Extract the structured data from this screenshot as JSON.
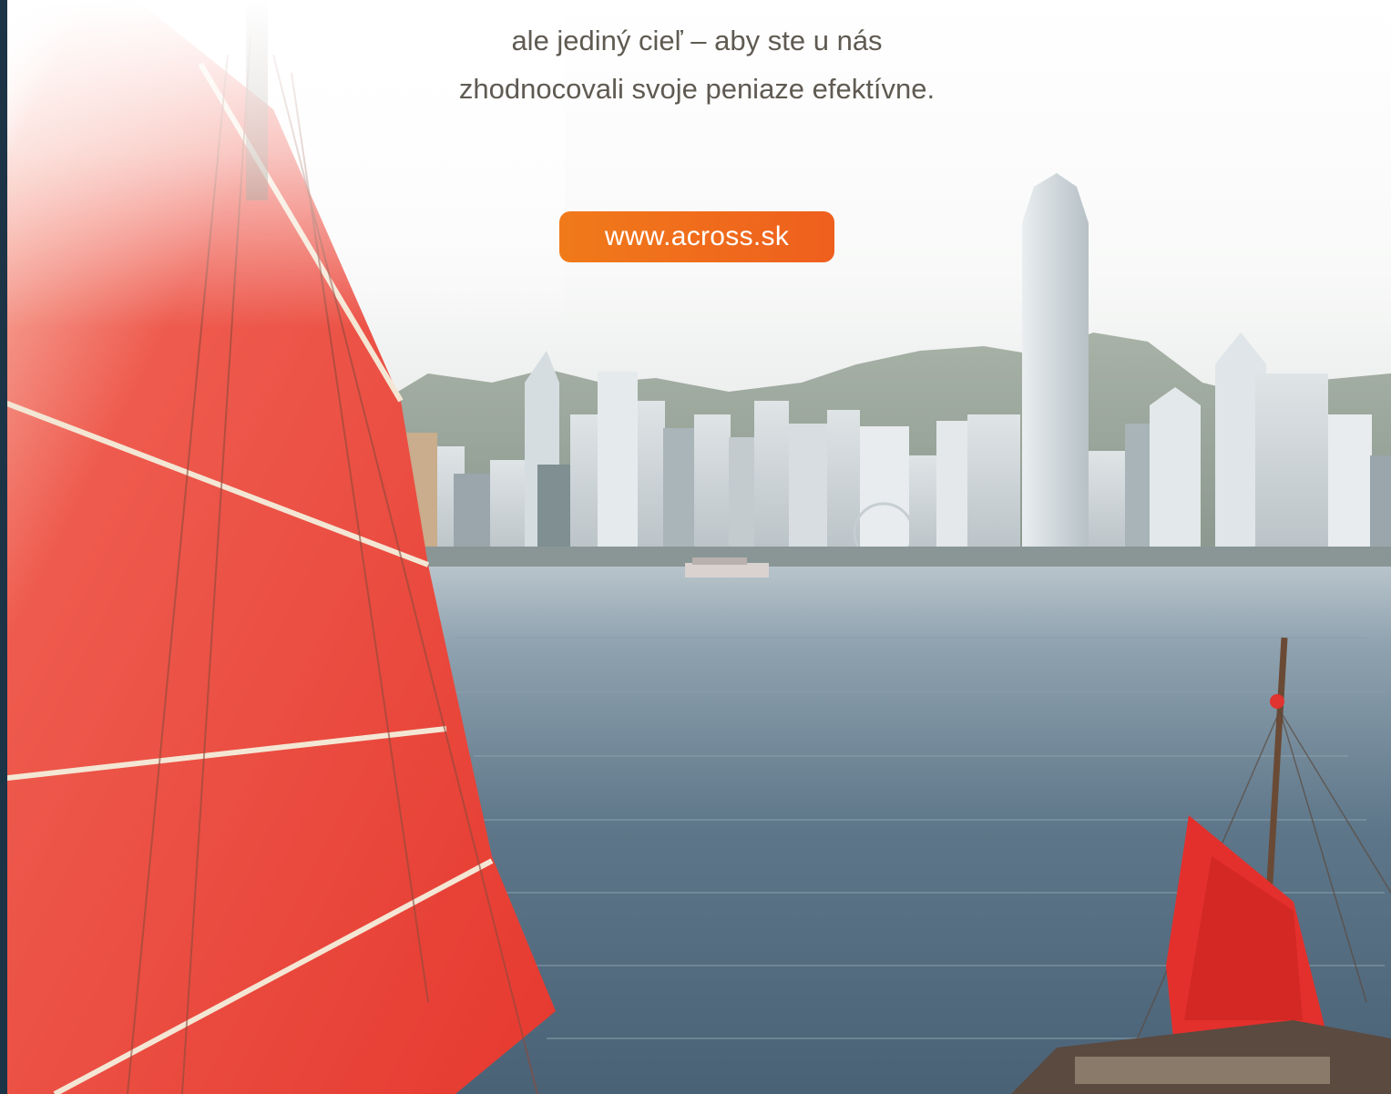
{
  "headline": {
    "line1": "ale jediný cieľ – aby ste u nás",
    "line2": "zhodnocovali svoje peniaze efektívne."
  },
  "cta": {
    "label": "www.across.sk"
  },
  "colors": {
    "text": "#5f5a52",
    "button_start": "#f07a1a",
    "button_end": "#ef5f1e",
    "sail": "#e8423a",
    "water": "#5a7387",
    "left_edge": "#1d3447"
  },
  "illustration": {
    "subject": "red junk boat sails in the foreground, Hong Kong skyline across Victoria Harbour"
  }
}
